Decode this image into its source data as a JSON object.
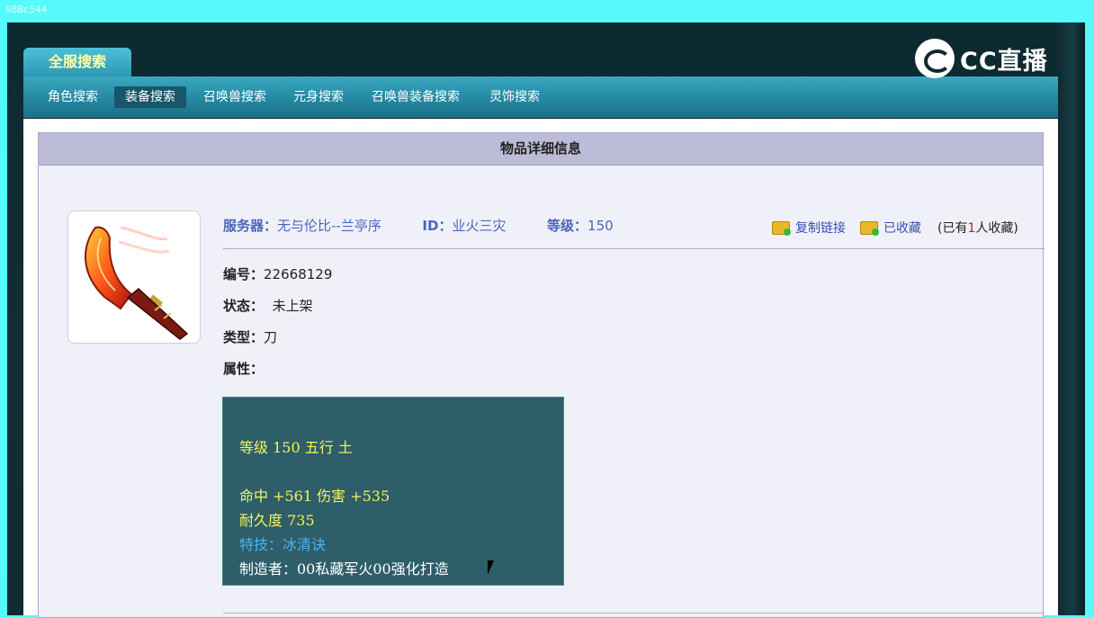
{
  "topbar": {
    "text": "98Bc544"
  },
  "header": {
    "main_tab": "全服搜索",
    "logo_text": "CC直播",
    "nav": [
      {
        "label": "角色搜索"
      },
      {
        "label": "装备搜索",
        "active": true
      },
      {
        "label": "召唤兽搜索"
      },
      {
        "label": "元身搜索"
      },
      {
        "label": "召唤兽装备搜索"
      },
      {
        "label": "灵饰搜索"
      }
    ]
  },
  "panel": {
    "title": "物品详细信息",
    "item": {
      "server_label": "服务器：",
      "server_value": "无与伦比--兰亭序",
      "id_label": "ID：",
      "id_value": "业火三灾",
      "level_label": "等级：",
      "level_value": "150",
      "copy_link": "复制链接",
      "favorited": "已收藏",
      "fav_count_prefix": "(已有",
      "fav_count": "1",
      "fav_count_suffix": "人收藏)",
      "number_label": "编号：",
      "number_value": "22668129",
      "status_label": "状态：",
      "status_value": "未上架",
      "type_label": "类型：",
      "type_value": "刀",
      "attr_label": "属性：",
      "attributes": {
        "line1": "等级 150 五行 土",
        "line2": "命中 +561 伤害 +535",
        "line3": "耐久度 735",
        "line4": "特技：冰清诀",
        "line5": "制造者：00私藏军火00强化打造"
      }
    }
  },
  "colors": {
    "nav_bg": "#2588a2",
    "attr_box_bg": "#2e5e6a",
    "attr_yellow": "#f4f45a",
    "attr_blue": "#4ab4f4",
    "label_blue": "#4a66b8"
  }
}
